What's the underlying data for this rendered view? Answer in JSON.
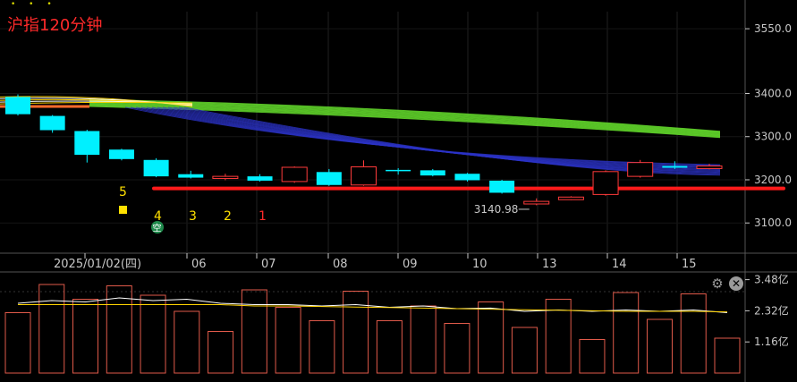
{
  "title": "沪指120分钟",
  "colors": {
    "up": "#ff3b3b",
    "down": "#00f0ff",
    "axis": "#c8c8c8",
    "support_line": "#ff1a1a",
    "green_band": "#5fd22a",
    "blue_band": "#2c33c8",
    "yellow_ma": "#ffd400",
    "marker": "#ffe000",
    "count_red": "#ff2a2a",
    "badge": "#1f8a4c"
  },
  "chart_data": {
    "type": "candlestick",
    "price_axis": {
      "ticks": [
        "3550.0",
        "3400.0",
        "3300.0",
        "3200.0",
        "3100.0"
      ],
      "values": [
        3550,
        3400,
        3300,
        3200,
        3100
      ]
    },
    "date_labels": [
      "2025/01/02(四)",
      "06",
      "07",
      "08",
      "09",
      "10",
      "13",
      "14",
      "15"
    ],
    "candles": [
      {
        "o": 3392,
        "c": 3352,
        "h": 3398,
        "l": 3349
      },
      {
        "o": 3348,
        "c": 3315,
        "h": 3350,
        "l": 3309
      },
      {
        "o": 3313,
        "c": 3258,
        "h": 3316,
        "l": 3240
      },
      {
        "o": 3270,
        "c": 3248,
        "h": 3272,
        "l": 3245
      },
      {
        "o": 3246,
        "c": 3208,
        "h": 3250,
        "l": 3206
      },
      {
        "o": 3213,
        "c": 3205,
        "h": 3221,
        "l": 3203
      },
      {
        "o": 3203,
        "c": 3208,
        "h": 3214,
        "l": 3199
      },
      {
        "o": 3208,
        "c": 3198,
        "h": 3213,
        "l": 3196
      },
      {
        "o": 3196,
        "c": 3229,
        "h": 3231,
        "l": 3193
      },
      {
        "o": 3218,
        "c": 3188,
        "h": 3225,
        "l": 3186
      },
      {
        "o": 3188,
        "c": 3230,
        "h": 3245,
        "l": 3186
      },
      {
        "o": 3223,
        "c": 3220,
        "h": 3227,
        "l": 3212
      },
      {
        "o": 3222,
        "c": 3210,
        "h": 3225,
        "l": 3208
      },
      {
        "o": 3214,
        "c": 3199,
        "h": 3216,
        "l": 3196
      },
      {
        "o": 3198,
        "c": 3170,
        "h": 3200,
        "l": 3168
      },
      {
        "o": 3144,
        "c": 3150,
        "h": 3157,
        "l": 3141
      },
      {
        "o": 3154,
        "c": 3160,
        "h": 3162,
        "l": 3153
      },
      {
        "o": 3166,
        "c": 3219,
        "h": 3222,
        "l": 3163
      },
      {
        "o": 3208,
        "c": 3240,
        "h": 3246,
        "l": 3205
      },
      {
        "o": 3232,
        "c": 3228,
        "h": 3243,
        "l": 3225
      },
      {
        "o": 3226,
        "c": 3232,
        "h": 3237,
        "l": 3224
      }
    ],
    "support_level": 3180,
    "low_annotation": "3140.98",
    "count_labels": [
      "5",
      "4",
      "3",
      "2",
      "1"
    ],
    "badge_label": "空",
    "volume": {
      "axis_ticks": [
        "3.48亿",
        "2.32亿",
        "1.16亿"
      ],
      "axis_values": [
        3.48,
        2.32,
        1.16
      ],
      "bars": [
        2.25,
        3.3,
        2.75,
        3.25,
        2.9,
        2.3,
        1.55,
        3.1,
        2.45,
        1.95,
        3.05,
        1.95,
        2.5,
        1.85,
        2.65,
        1.7,
        2.75,
        1.25,
        3.0,
        2.0,
        2.95,
        1.3
      ],
      "ma_line": [
        2.6,
        2.7,
        2.65,
        2.8,
        2.7,
        2.75,
        2.6,
        2.55,
        2.55,
        2.5,
        2.55,
        2.45,
        2.5,
        2.4,
        2.42,
        2.3,
        2.35,
        2.3,
        2.35,
        2.3,
        2.35,
        2.25
      ],
      "ma_line2": [
        2.55,
        2.55,
        2.55,
        2.55,
        2.55,
        2.55,
        2.55,
        2.5,
        2.5,
        2.48,
        2.46,
        2.44,
        2.42,
        2.4,
        2.38,
        2.36,
        2.34,
        2.32,
        2.3,
        2.3,
        2.3,
        2.28
      ]
    },
    "price_range": [
      3030,
      3600
    ],
    "volume_range": [
      0,
      3.7
    ]
  }
}
